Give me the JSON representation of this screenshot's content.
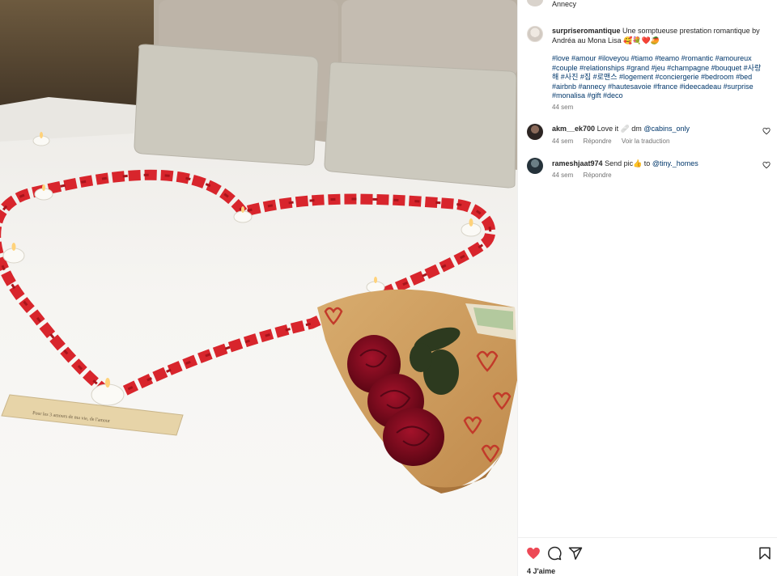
{
  "header": {
    "location": "Annecy"
  },
  "post": {
    "username": "surpriseromantique",
    "caption": "Une somptueuse prestation romantique by Andréa au Mona Lisa 🥰💐❤️🥭",
    "hashtags": "#love #amour #iloveyou #tiamo #teamo #romantic #amoureux #couple #relationships #grand #jeu #champagne #bouquet #사랑해 #사진 #집 #로맨스 #logement #conciergerie #bedroom #bed #airbnb #annecy #hautesavoie #france #ideecadeau #surprise #monalisa #gift #deco",
    "time": "44 sem"
  },
  "comments": [
    {
      "username": "akm__ek700",
      "text": "Love it 🩹 dm ",
      "mention": "@cabins_only",
      "time": "44 sem",
      "reply_label": "Répondre",
      "translate_label": "Voir la traduction"
    },
    {
      "username": "rameshjaat974",
      "text": "Send pic👍 to ",
      "mention": "@tiny._homes",
      "time": "44 sem",
      "reply_label": "Répondre"
    }
  ],
  "actions": {
    "likes_label": "4 J'aime"
  },
  "photo": {
    "card_text": "Pour les 3 amours de ma vie, de l'amour"
  },
  "colors": {
    "like_active": "#ed4956",
    "link": "#00376b",
    "meta": "#737373",
    "petals": "#d8252c"
  },
  "icons": [
    "heart-filled-icon",
    "comment-icon",
    "share-icon",
    "bookmark-icon",
    "heart-outline-icon"
  ]
}
